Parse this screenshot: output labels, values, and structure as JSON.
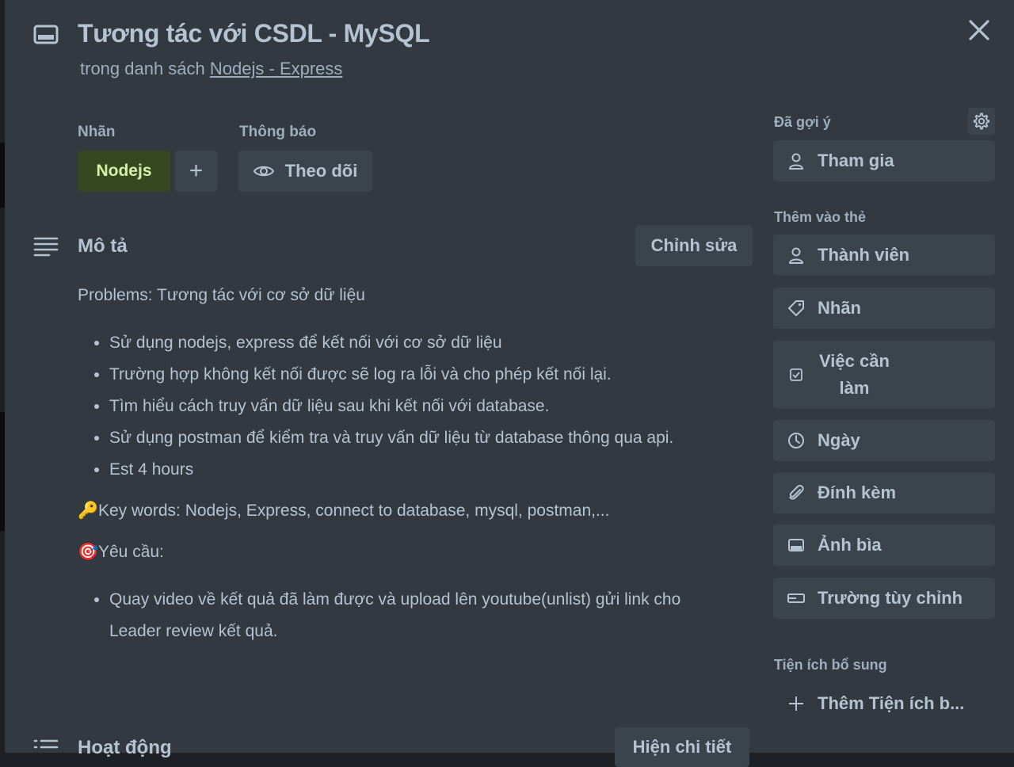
{
  "card": {
    "title": "Tương tác với CSDL - MySQL",
    "list_prefix": "trong danh sách",
    "list_name": "Nodejs - Express"
  },
  "labels_section": {
    "label": "Nhãn",
    "chip": "Nodejs",
    "add": "+",
    "chip_color": "#37471f"
  },
  "notify_section": {
    "label": "Thông báo",
    "watch_button": "Theo dõi"
  },
  "description": {
    "heading": "Mô tả",
    "edit_button": "Chỉnh sửa",
    "problems": "Problems: Tương tác với cơ sở dữ liệu",
    "items": [
      "Sử dụng nodejs, express để kết nối với cơ sở dữ liệu",
      "Trường hợp không kết nối được sẽ log ra lỗi và cho phép kết nối lại.",
      "Tìm hiểu cách truy vấn dữ liệu sau khi kết nối với database.",
      "Sử dụng postman để kiểm tra và truy vấn dữ liệu từ database thông qua api.",
      "Est 4 hours"
    ],
    "keywords": "Key words: Nodejs, Express, connect to database, mysql, postman,...",
    "requirements_label": "Yêu cầu:",
    "requirements": [
      "Quay video về kết quả đã làm được và upload lên youtube(unlist) gửi link cho Leader review kết quả."
    ]
  },
  "activity": {
    "heading": "Hoạt động",
    "details_button": "Hiện chi tiết"
  },
  "sidebar": {
    "suggested_label": "Đã gợi ý",
    "join": "Tham gia",
    "add_to_card_label": "Thêm vào thẻ",
    "members": "Thành viên",
    "labels": "Nhãn",
    "checklist_line1": "Việc cần",
    "checklist_line2": "làm",
    "dates": "Ngày",
    "attachment": "Đính kèm",
    "cover": "Ảnh bìa",
    "custom_fields": "Trường tùy chỉnh",
    "powerups_label": "Tiện ích bổ sung",
    "add_powerup": "Thêm Tiện ích b..."
  }
}
